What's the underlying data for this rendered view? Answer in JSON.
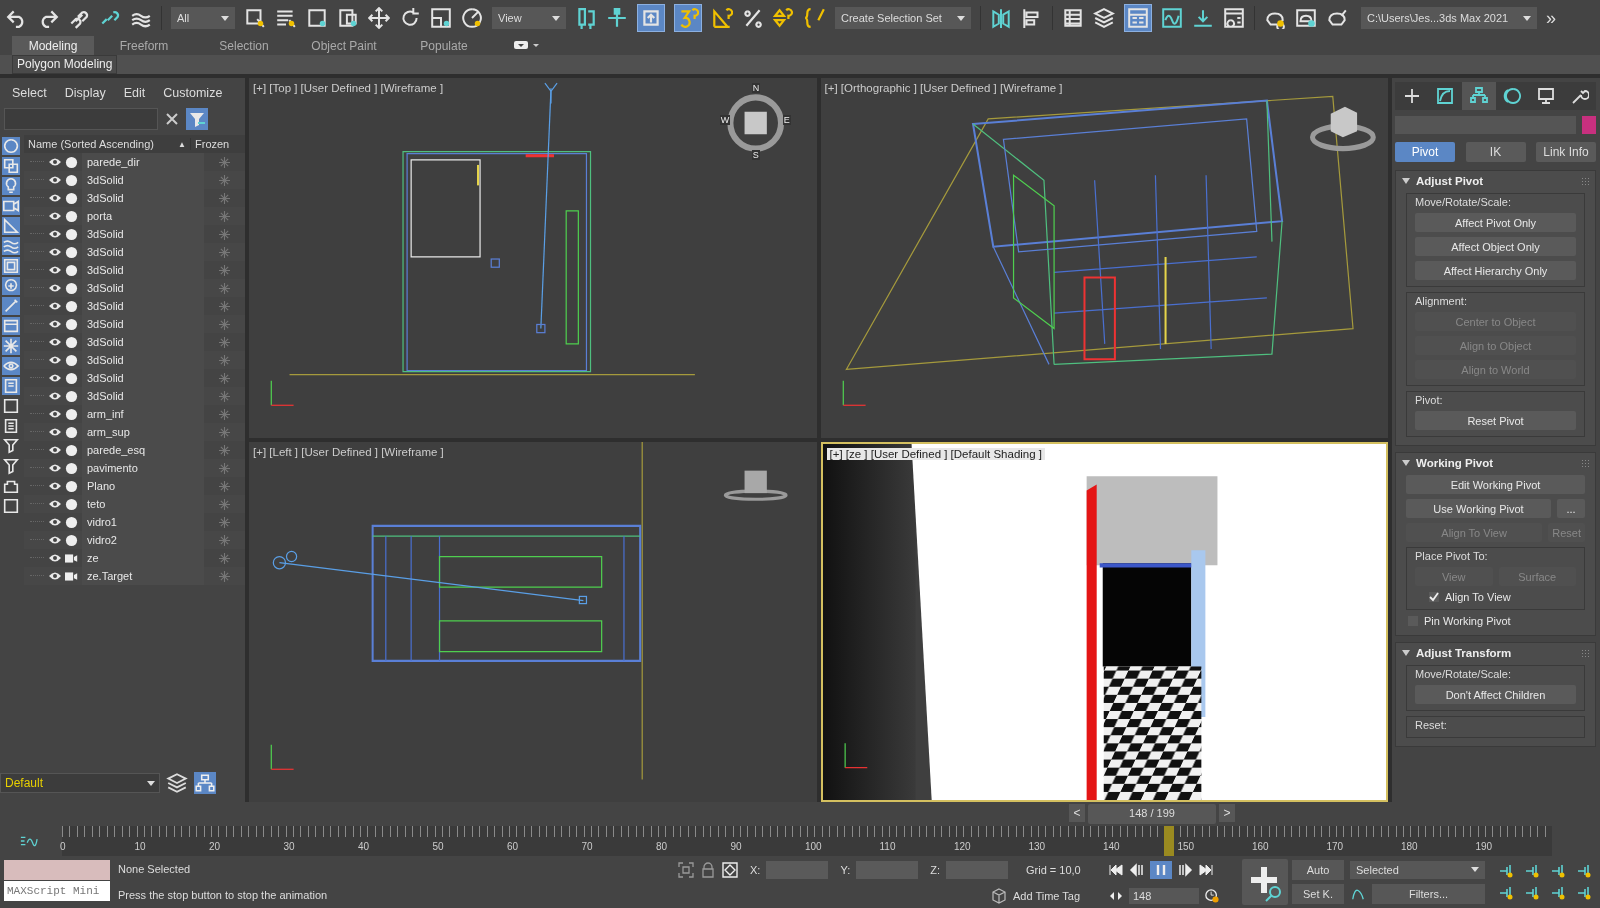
{
  "toolbar": {
    "selection_filter": "All",
    "ref_coord": "View",
    "selection_set": "Create Selection Set",
    "project_path": "C:\\Users\\Jes...3ds Max 2021",
    "overflow": "»",
    "toggles": [
      {
        "selected": true
      },
      {
        "selected": true
      },
      {
        "selected": true
      }
    ]
  },
  "ribbon_tabs": [
    {
      "label": "Modeling",
      "selected": true
    },
    {
      "label": "Freeform",
      "selected": false
    },
    {
      "label": "Selection",
      "selected": false
    },
    {
      "label": "Object Paint",
      "selected": false
    },
    {
      "label": "Populate",
      "selected": false
    }
  ],
  "ribbon_panel": "Polygon Modeling",
  "scene_explorer": {
    "menu": [
      "Select",
      "Display",
      "Edit",
      "Customize"
    ],
    "columns": [
      "Name (Sorted Ascending)",
      "Frozen"
    ],
    "sort_mark": "▲",
    "filters": [
      {
        "on": true
      },
      {
        "on": true
      },
      {
        "on": true
      },
      {
        "on": true
      },
      {
        "on": true
      },
      {
        "on": true
      },
      {
        "on": true
      },
      {
        "on": true
      },
      {
        "on": true
      },
      {
        "on": true
      },
      {
        "on": true
      },
      {
        "on": true
      },
      {
        "on": true
      },
      {
        "on": false
      },
      {
        "on": false
      },
      {
        "on": false
      },
      {
        "on": false
      },
      {
        "on": false
      },
      {
        "on": false
      }
    ],
    "rows": [
      {
        "name": "parede_dir",
        "kind": "geometry"
      },
      {
        "name": "3dSolid",
        "kind": "geometry"
      },
      {
        "name": "3dSolid",
        "kind": "geometry"
      },
      {
        "name": "porta",
        "kind": "geometry"
      },
      {
        "name": "3dSolid",
        "kind": "geometry"
      },
      {
        "name": "3dSolid",
        "kind": "geometry"
      },
      {
        "name": "3dSolid",
        "kind": "geometry"
      },
      {
        "name": "3dSolid",
        "kind": "geometry"
      },
      {
        "name": "3dSolid",
        "kind": "geometry"
      },
      {
        "name": "3dSolid",
        "kind": "geometry"
      },
      {
        "name": "3dSolid",
        "kind": "geometry"
      },
      {
        "name": "3dSolid",
        "kind": "geometry"
      },
      {
        "name": "3dSolid",
        "kind": "geometry"
      },
      {
        "name": "3dSolid",
        "kind": "geometry"
      },
      {
        "name": "arm_inf",
        "kind": "geometry"
      },
      {
        "name": "arm_sup",
        "kind": "geometry"
      },
      {
        "name": "parede_esq",
        "kind": "geometry"
      },
      {
        "name": "pavimento",
        "kind": "geometry"
      },
      {
        "name": "Plano",
        "kind": "geometry"
      },
      {
        "name": "teto",
        "kind": "geometry"
      },
      {
        "name": "vidro1",
        "kind": "geometry"
      },
      {
        "name": "vidro2",
        "kind": "geometry"
      },
      {
        "name": "ze",
        "kind": "camera"
      },
      {
        "name": "ze.Target",
        "kind": "camera"
      }
    ],
    "layer": "Default"
  },
  "viewports": [
    {
      "label": "[+] [Top ] [User Defined ] [Wireframe ]",
      "kind": "top",
      "compass": [
        "N",
        "E",
        "S",
        "W"
      ]
    },
    {
      "label": "[+] [Orthographic ] [User Defined ] [Wireframe ]",
      "kind": "ortho"
    },
    {
      "label": "[+] [Left ] [User Defined ] [Wireframe ]",
      "kind": "left"
    },
    {
      "label": "[+] [ze ] [User Defined ] [Default Shading ]",
      "kind": "camera"
    }
  ],
  "command_panel": {
    "tabs": [
      {
        "selected": false
      },
      {
        "selected": false
      },
      {
        "selected": true
      },
      {
        "selected": false
      },
      {
        "selected": false
      },
      {
        "selected": false
      }
    ],
    "subtabs": [
      {
        "label": "Pivot",
        "selected": true
      },
      {
        "label": "IK",
        "selected": false
      },
      {
        "label": "Link Info",
        "selected": false
      }
    ],
    "rollouts": [
      {
        "title": "Adjust Pivot",
        "expanded": true,
        "items": [
          {
            "kind": "group",
            "title": "Move/Rotate/Scale:",
            "items": [
              {
                "kind": "buttons",
                "buttons": [
                  {
                    "label": "Affect Pivot Only",
                    "disabled": false
                  }
                ]
              },
              {
                "kind": "buttons",
                "buttons": [
                  {
                    "label": "Affect Object Only",
                    "disabled": false
                  }
                ]
              },
              {
                "kind": "buttons",
                "buttons": [
                  {
                    "label": "Affect Hierarchy Only",
                    "disabled": false
                  }
                ]
              }
            ]
          },
          {
            "kind": "group",
            "title": "Alignment:",
            "items": [
              {
                "kind": "buttons",
                "buttons": [
                  {
                    "label": "Center to Object",
                    "disabled": true
                  }
                ]
              },
              {
                "kind": "buttons",
                "buttons": [
                  {
                    "label": "Align to Object",
                    "disabled": true
                  }
                ]
              },
              {
                "kind": "buttons",
                "buttons": [
                  {
                    "label": "Align to World",
                    "disabled": true
                  }
                ]
              }
            ]
          },
          {
            "kind": "group",
            "title": "Pivot:",
            "items": [
              {
                "kind": "buttons",
                "buttons": [
                  {
                    "label": "Reset Pivot",
                    "disabled": false
                  }
                ]
              }
            ]
          }
        ]
      },
      {
        "title": "Working Pivot",
        "expanded": true,
        "items": [
          {
            "kind": "buttons",
            "buttons": [
              {
                "label": "Edit Working Pivot",
                "disabled": false
              }
            ]
          },
          {
            "kind": "buttons",
            "buttons": [
              {
                "label": "Use Working Pivot",
                "disabled": false
              },
              {
                "label": "...",
                "disabled": false
              }
            ]
          },
          {
            "kind": "buttons",
            "buttons": [
              {
                "label": "Align To View",
                "disabled": true
              },
              {
                "label": "Reset",
                "disabled": true
              }
            ]
          },
          {
            "kind": "group",
            "title": "Place Pivot To:",
            "items": [
              {
                "kind": "buttons",
                "buttons": [
                  {
                    "label": "View",
                    "disabled": true
                  },
                  {
                    "label": "Surface",
                    "disabled": true
                  }
                ]
              },
              {
                "kind": "checkbox",
                "label": "Align To View",
                "checked": true
              }
            ]
          },
          {
            "kind": "checkbox",
            "label": "Pin Working Pivot",
            "checked": false
          }
        ]
      },
      {
        "title": "Adjust Transform",
        "expanded": true,
        "items": [
          {
            "kind": "group",
            "title": "Move/Rotate/Scale:",
            "items": [
              {
                "kind": "buttons",
                "buttons": [
                  {
                    "label": "Don't Affect Children",
                    "disabled": false
                  }
                ]
              }
            ]
          },
          {
            "kind": "group",
            "title": "Reset:"
          }
        ]
      }
    ]
  },
  "time_slider": {
    "label": "148 / 199",
    "prev": "<",
    "next": ">"
  },
  "trackbar": {
    "ticks": [
      "0",
      "10",
      "20",
      "30",
      "40",
      "50",
      "60",
      "70",
      "80",
      "90",
      "100",
      "110",
      "120",
      "130",
      "140",
      "150",
      "160",
      "170",
      "180",
      "190"
    ]
  },
  "status": {
    "maxscript": "MAXScript Mini",
    "selection": "None Selected",
    "prompt": "Press the stop button to stop the animation",
    "x_label": "X:",
    "y_label": "Y:",
    "z_label": "Z:",
    "grid": "Grid = 10,0",
    "time_tag": "Add Time Tag",
    "frame": "148",
    "auto": "Auto",
    "set_key": "Set K.",
    "key_filter": "Selected",
    "filters": "Filters..."
  }
}
